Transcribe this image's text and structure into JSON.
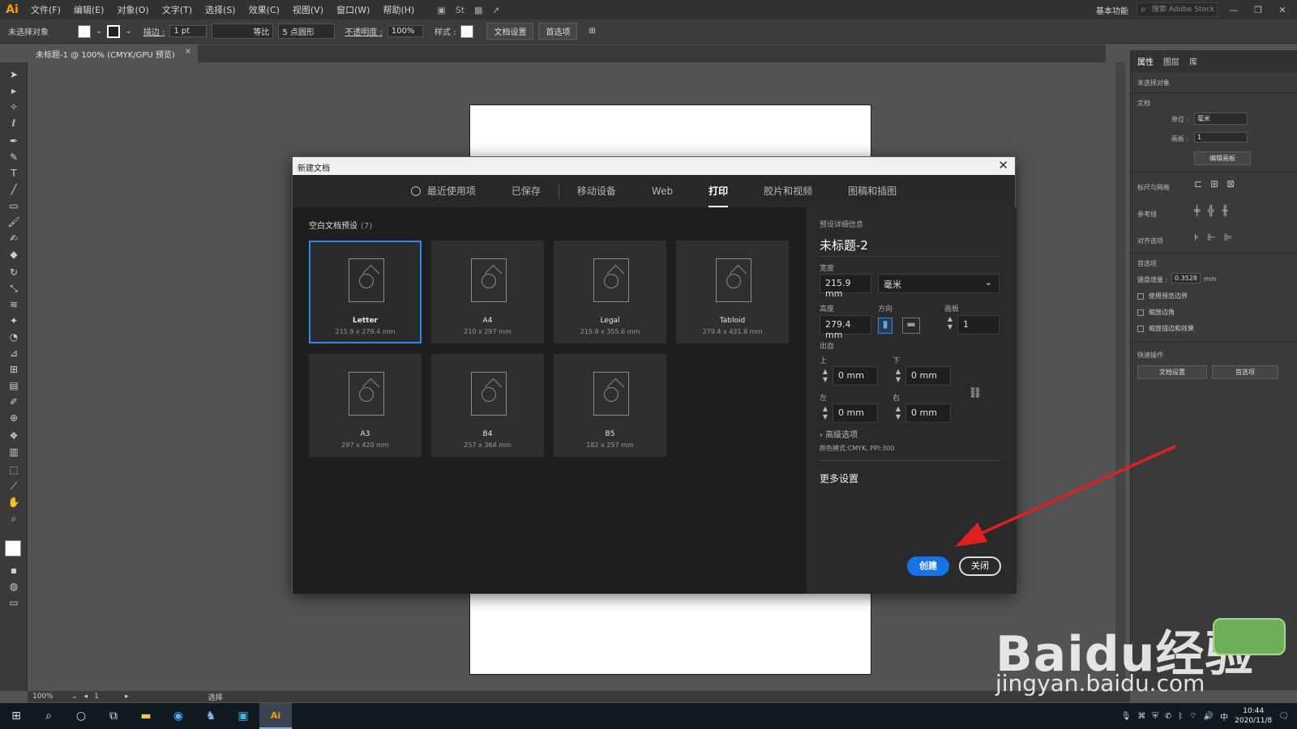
{
  "app": {
    "logo": "Ai",
    "menus": [
      "文件(F)",
      "编辑(E)",
      "对象(O)",
      "文字(T)",
      "选择(S)",
      "效果(C)",
      "视图(V)",
      "窗口(W)",
      "帮助(H)"
    ],
    "workspace": "基本功能",
    "search_placeholder": "搜索 Adobe Stock"
  },
  "control_bar": {
    "selection": "未选择对象",
    "stroke_label": "描边 :",
    "stroke_value": "1 pt",
    "stroke_style": "等比",
    "brush": "5 点圆形",
    "opacity_label": "不透明度 :",
    "opacity_value": "100%",
    "style_label": "样式 :",
    "doc_setup": "文档设置",
    "prefs": "首选项"
  },
  "document_tab": {
    "title": "未标题-1 @ 100% (CMYK/GPU 预览)",
    "close": "×"
  },
  "right_panel": {
    "tabs": [
      "属性",
      "图层",
      "库"
    ],
    "no_selection": "未选择对象",
    "document": "文档",
    "unit_label": "单位 :",
    "unit_value": "毫米",
    "artboard_label": "画板 :",
    "artboard_value": "1",
    "edit_artboard": "编辑画板",
    "rulers_grids": "标尺与网格",
    "guides": "参考线",
    "align": "对齐选项",
    "prefs_title": "首选项",
    "keyboard_inc_label": "键盘增量 :",
    "keyboard_inc_value": "0.3528",
    "keyboard_inc_unit": "mm",
    "chk1": "使用预览边界",
    "chk2": "缩放边角",
    "chk3": "缩放描边和效果",
    "quick_actions": "快速操作",
    "btn_doc_setup": "文档设置",
    "btn_prefs": "首选项"
  },
  "status_bar": {
    "zoom": "100%",
    "page": "1",
    "mode": "选择"
  },
  "dialog": {
    "title": "新建文档",
    "tabs": [
      "最近使用项",
      "已保存",
      "移动设备",
      "Web",
      "打印",
      "胶片和视频",
      "图稿和插图"
    ],
    "active_tab": "打印",
    "presets_title": "空白文档预设",
    "presets_count": "(7)",
    "presets": [
      {
        "name": "Letter",
        "size": "215.9 x 279.4 mm",
        "selected": true
      },
      {
        "name": "A4",
        "size": "210 x 297 mm",
        "selected": false
      },
      {
        "name": "Legal",
        "size": "215.9 x 355.6 mm",
        "selected": false
      },
      {
        "name": "Tabloid",
        "size": "279.4 x 431.8 mm",
        "selected": false
      },
      {
        "name": "A3",
        "size": "297 x 420 mm",
        "selected": false
      },
      {
        "name": "B4",
        "size": "257 x 364 mm",
        "selected": false
      },
      {
        "name": "B5",
        "size": "182 x 257 mm",
        "selected": false
      }
    ],
    "details": {
      "header": "预设详细信息",
      "doc_name": "未标题-2",
      "width_label": "宽度",
      "width_value": "215.9 mm",
      "unit_value": "毫米",
      "height_label": "高度",
      "height_value": "279.4 mm",
      "orientation_label": "方向",
      "artboards_label": "画板",
      "artboards_value": "1",
      "bleed_label": "出血",
      "top_label": "上",
      "top_value": "0 mm",
      "bottom_label": "下",
      "bottom_value": "0 mm",
      "left_label": "左",
      "left_value": "0 mm",
      "right_label": "右",
      "right_value": "0 mm",
      "advanced": "高级选项",
      "color_mode": "颜色模式:CMYK, PPI:300",
      "more_settings": "更多设置",
      "create": "创建",
      "close": "关闭"
    }
  },
  "watermark": {
    "brand": "Baidu经验",
    "url": "jingyan.baidu.com"
  },
  "taskbar": {
    "time": "10:44",
    "date": "2020/11/8"
  },
  "colors": {
    "accent": "#1473e6",
    "selected_border": "#2d8ceb",
    "arrow": "#e02020"
  }
}
